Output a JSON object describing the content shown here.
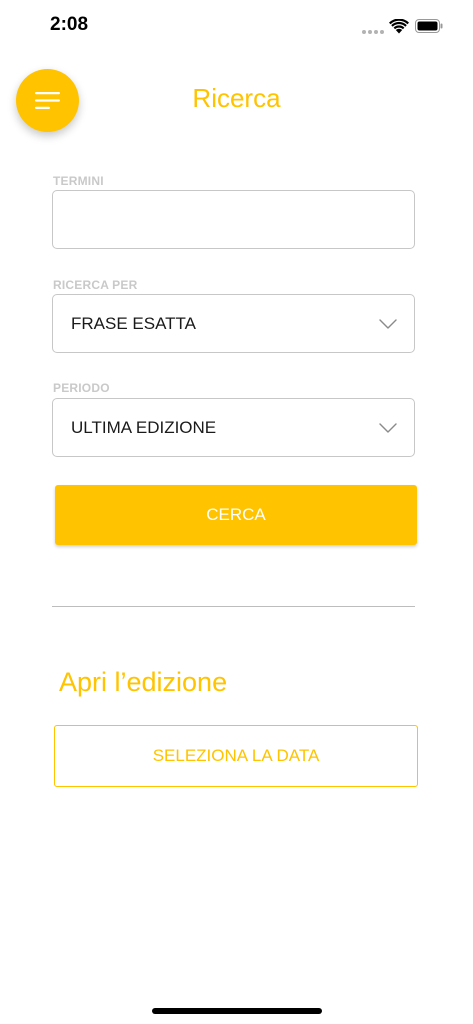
{
  "status_bar": {
    "time": "2:08"
  },
  "header": {
    "title": "Ricerca",
    "menu_icon": "hamburger-menu-icon"
  },
  "form": {
    "terms": {
      "label": "TERMINI",
      "value": "",
      "placeholder": ""
    },
    "search_by": {
      "label": "RICERCA PER",
      "selected": "FRASE ESATTA"
    },
    "period": {
      "label": "PERIODO",
      "selected": "ULTIMA EDIZIONE"
    },
    "submit_label": "CERCA"
  },
  "edition": {
    "title": "Apri l’edizione",
    "select_date_label": "SELEZIONA LA DATA"
  },
  "colors": {
    "accent": "#ffc300",
    "label_gray": "#c9c9c9",
    "border_gray": "#c7c7c7"
  }
}
